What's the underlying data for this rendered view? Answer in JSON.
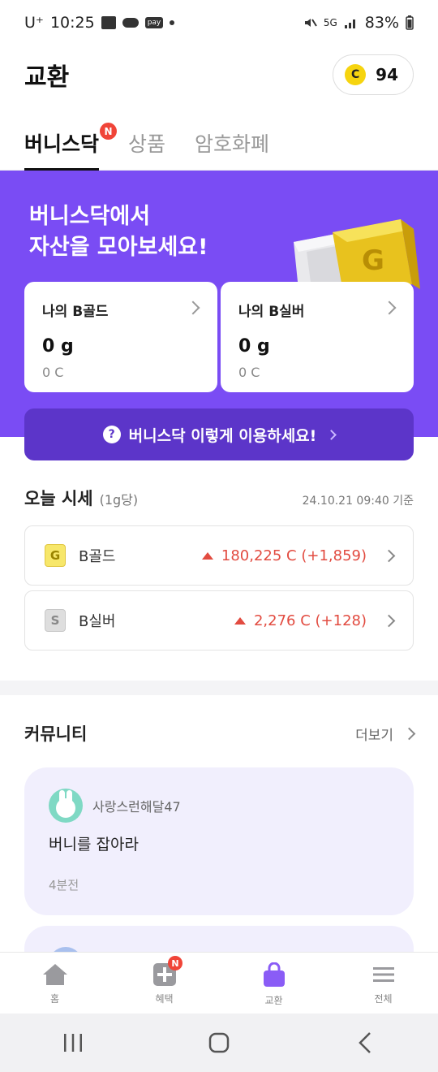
{
  "status_bar": {
    "carrier": "U⁺",
    "time": "10:25",
    "pay_label": "pay",
    "network": "5G",
    "battery": "83%"
  },
  "header": {
    "title": "교환",
    "coin_label": "C",
    "coin_balance": "94"
  },
  "tabs": [
    {
      "label": "버니스닥",
      "badge": "N",
      "active": true
    },
    {
      "label": "상품",
      "active": false
    },
    {
      "label": "암호화폐",
      "active": false
    }
  ],
  "banner": {
    "title_line1": "버니스닥에서",
    "title_line2": "자산을 모아보세요!",
    "bar_letter": "G",
    "bg_color": "#7a4cf4"
  },
  "assets": [
    {
      "label": "나의 B골드",
      "amount": "0 g",
      "coin_amount": "0 C"
    },
    {
      "label": "나의 B실버",
      "amount": "0 g",
      "coin_amount": "0 C"
    }
  ],
  "help": {
    "icon": "?",
    "label": "버니스닥 이렇게 이용하세요!"
  },
  "prices": {
    "title": "오늘 시세",
    "unit": "(1g당)",
    "timestamp": "24.10.21 09:40 기준",
    "items": [
      {
        "icon_letter": "G",
        "name": "B골드",
        "value": "180,225 C (+1,859)",
        "direction": "up"
      },
      {
        "icon_letter": "S",
        "name": "B실버",
        "value": "2,276 C (+128)",
        "direction": "up"
      }
    ]
  },
  "community": {
    "title": "커뮤니티",
    "more_label": "더보기",
    "posts": [
      {
        "user": "사랑스런해달47",
        "text": "버니를 잡아라",
        "time": "4분전"
      }
    ]
  },
  "bottom_nav": [
    {
      "label": "홈",
      "icon": "home-icon"
    },
    {
      "label": "혜택",
      "icon": "plus-box-icon",
      "badge": "N"
    },
    {
      "label": "교환",
      "icon": "shopping-bag-icon",
      "active": true
    },
    {
      "label": "전체",
      "icon": "menu-icon"
    }
  ],
  "colors": {
    "accent": "#7a4cf4",
    "accent_dark": "#5c35c9",
    "price_up": "#e24b40",
    "badge": "#f04438"
  }
}
